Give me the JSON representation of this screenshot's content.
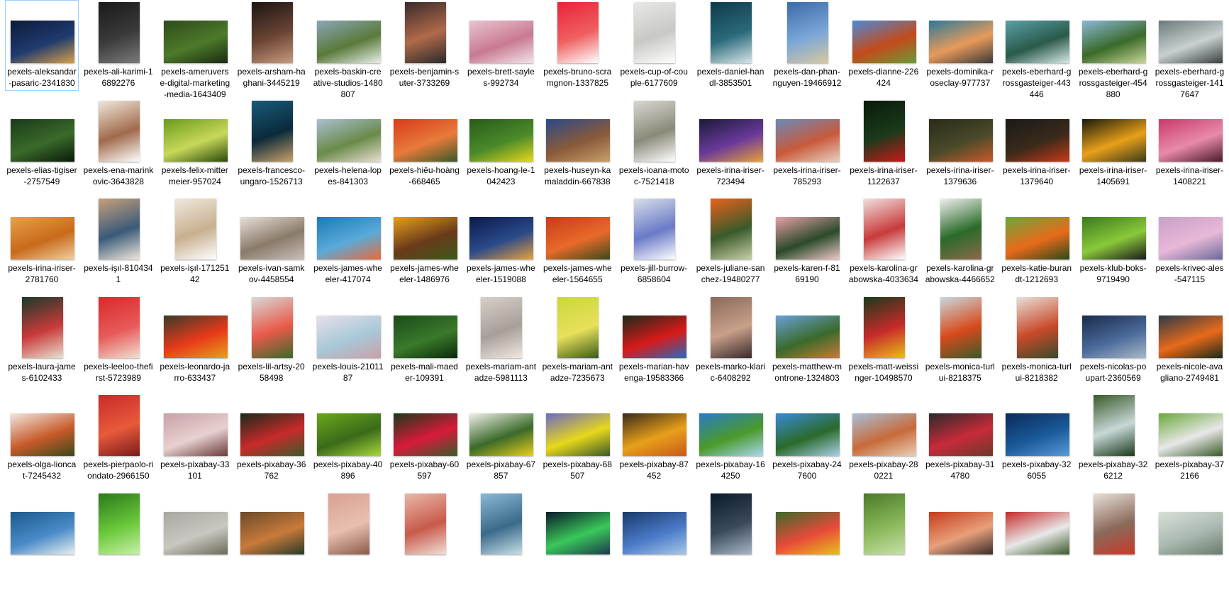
{
  "window": {},
  "files": [
    {
      "name": "pexels-aleksandar-pasaric-2341830",
      "orientation": "landscape",
      "colors": [
        "#0d1a3a",
        "#1f3b6e",
        "#d9a04a"
      ],
      "selected": true
    },
    {
      "name": "pexels-ali-karimi-16892276",
      "orientation": "portrait",
      "colors": [
        "#1a1a1a",
        "#3a3a3a",
        "#7a7a7a"
      ]
    },
    {
      "name": "pexels-ameruverse-digital-marketing-media-1643409",
      "orientation": "landscape",
      "colors": [
        "#2e4a1c",
        "#4c7a2a",
        "#1b2a10"
      ]
    },
    {
      "name": "pexels-arsham-haghani-3445219",
      "orientation": "portrait",
      "colors": [
        "#1c1412",
        "#6a4434",
        "#c89a80"
      ]
    },
    {
      "name": "pexels-baskin-creative-studios-1480807",
      "orientation": "landscape",
      "colors": [
        "#8aa6b8",
        "#5a7a3a",
        "#e9efe8"
      ]
    },
    {
      "name": "pexels-benjamin-suter-3733269",
      "orientation": "portrait",
      "colors": [
        "#3a2a2a",
        "#b06a4a",
        "#2a2a2a"
      ]
    },
    {
      "name": "pexels-brett-sayles-992734",
      "orientation": "landscape",
      "colors": [
        "#e9c4cf",
        "#c97a93",
        "#f2e4e8"
      ]
    },
    {
      "name": "pexels-bruno-scramgnon-1337825",
      "orientation": "portrait",
      "colors": [
        "#e8223a",
        "#f06060",
        "#ffffff"
      ]
    },
    {
      "name": "pexels-cup-of-couple-6177609",
      "orientation": "portrait",
      "colors": [
        "#e8e8e6",
        "#c8c8c4",
        "#ffffff"
      ]
    },
    {
      "name": "pexels-daniel-handl-3853501",
      "orientation": "portrait",
      "colors": [
        "#0f3a4a",
        "#2a6a7a",
        "#d8e6ea"
      ]
    },
    {
      "name": "pexels-dan-phan-nguyen-19466912",
      "orientation": "portrait",
      "colors": [
        "#3a6aa8",
        "#7aa6d8",
        "#d8c8a0"
      ]
    },
    {
      "name": "pexels-dianne-226424",
      "orientation": "landscape",
      "colors": [
        "#4a8ad8",
        "#c44a1a",
        "#6a9a3a"
      ]
    },
    {
      "name": "pexels-dominika-roseclay-977737",
      "orientation": "landscape",
      "colors": [
        "#2a7a9a",
        "#e89a5a",
        "#3a3a3a"
      ]
    },
    {
      "name": "pexels-eberhard-grossgasteiger-443446",
      "orientation": "landscape",
      "colors": [
        "#5aa0a8",
        "#2a5a4a",
        "#d8e8e8"
      ]
    },
    {
      "name": "pexels-eberhard-grossgasteiger-454880",
      "orientation": "landscape",
      "colors": [
        "#8ab8d8",
        "#3a6a2a",
        "#c8d898"
      ]
    },
    {
      "name": "pexels-eberhard-grossgasteiger-1417647",
      "orientation": "landscape",
      "colors": [
        "#6a7a7a",
        "#c8d0d0",
        "#3a4040"
      ]
    },
    {
      "name": "pexels-elias-tigiser-2757549",
      "orientation": "landscape",
      "colors": [
        "#1a3a1a",
        "#3a6a2a",
        "#0a1a0a"
      ]
    },
    {
      "name": "pexels-ena-marinkovic-3643828",
      "orientation": "portrait",
      "colors": [
        "#f0e8dc",
        "#a06a4a",
        "#ffffff"
      ]
    },
    {
      "name": "pexels-felix-mittermeier-957024",
      "orientation": "landscape",
      "colors": [
        "#6a9a1a",
        "#c8d85a",
        "#2a4a0a"
      ]
    },
    {
      "name": "pexels-francesco-ungaro-1526713",
      "orientation": "portrait",
      "colors": [
        "#1a5a7a",
        "#0a2a3a",
        "#c8a06a"
      ]
    },
    {
      "name": "pexels-helena-lopes-841303",
      "orientation": "landscape",
      "colors": [
        "#a8c0d0",
        "#6a8a4a",
        "#e8e0d0"
      ]
    },
    {
      "name": "pexels-hiêu-hoàng-668465",
      "orientation": "landscape",
      "colors": [
        "#d83a1a",
        "#e87a3a",
        "#3a5a2a"
      ]
    },
    {
      "name": "pexels-hoang-le-1042423",
      "orientation": "landscape",
      "colors": [
        "#2a5a1a",
        "#4a8a2a",
        "#e8d81a"
      ]
    },
    {
      "name": "pexels-huseyn-kamaladdin-667838",
      "orientation": "landscape",
      "colors": [
        "#2a4a8a",
        "#8a5a3a",
        "#c8a06a"
      ]
    },
    {
      "name": "pexels-ioana-motoc-7521418",
      "orientation": "portrait",
      "colors": [
        "#d8d8d0",
        "#8a8a7a",
        "#ffffff"
      ]
    },
    {
      "name": "pexels-irina-iriser-723494",
      "orientation": "landscape",
      "colors": [
        "#1a1a3a",
        "#6a3a9a",
        "#e8a03a"
      ]
    },
    {
      "name": "pexels-irina-iriser-785293",
      "orientation": "landscape",
      "colors": [
        "#6a8ab8",
        "#c85a3a",
        "#e8d0c0"
      ]
    },
    {
      "name": "pexels-irina-iriser-1122637",
      "orientation": "portrait",
      "colors": [
        "#0a1a0a",
        "#1a3a1a",
        "#c81a1a"
      ]
    },
    {
      "name": "pexels-irina-iriser-1379636",
      "orientation": "landscape",
      "colors": [
        "#2a2a1a",
        "#4a4a2a",
        "#c85a2a"
      ]
    },
    {
      "name": "pexels-irina-iriser-1379640",
      "orientation": "landscape",
      "colors": [
        "#1a1a1a",
        "#3a2a1a",
        "#c83a1a"
      ]
    },
    {
      "name": "pexels-irina-iriser-1405691",
      "orientation": "landscape",
      "colors": [
        "#1a1a0a",
        "#e8a01a",
        "#3a3a1a"
      ]
    },
    {
      "name": "pexels-irina-iriser-1408221",
      "orientation": "landscape",
      "colors": [
        "#c83a6a",
        "#e88aaa",
        "#4a1a2a"
      ]
    },
    {
      "name": "pexels-irina-iriser-2781760",
      "orientation": "landscape",
      "colors": [
        "#e8a04a",
        "#c86a1a",
        "#f0d0a0"
      ]
    },
    {
      "name": "pexels-işıl-8104341",
      "orientation": "portrait",
      "colors": [
        "#c8a07a",
        "#3a5a7a",
        "#f0e8d8"
      ]
    },
    {
      "name": "pexels-işıl-17125142",
      "orientation": "portrait",
      "colors": [
        "#f0e8dc",
        "#c8b090",
        "#ffffff"
      ]
    },
    {
      "name": "pexels-ivan-samkov-4458554",
      "orientation": "landscape",
      "colors": [
        "#e8e0d8",
        "#8a7a6a",
        "#c8c0b8"
      ]
    },
    {
      "name": "pexels-james-wheeler-417074",
      "orientation": "landscape",
      "colors": [
        "#1a7ab8",
        "#5aaad8",
        "#e86a3a"
      ]
    },
    {
      "name": "pexels-james-wheeler-1486976",
      "orientation": "landscape",
      "colors": [
        "#e8a01a",
        "#6a3a1a",
        "#3a5a1a"
      ]
    },
    {
      "name": "pexels-james-wheeler-1519088",
      "orientation": "landscape",
      "colors": [
        "#0a1a4a",
        "#2a4a8a",
        "#e8a03a"
      ]
    },
    {
      "name": "pexels-james-wheeler-1564655",
      "orientation": "landscape",
      "colors": [
        "#c83a1a",
        "#e86a2a",
        "#3a4a1a"
      ]
    },
    {
      "name": "pexels-jill-burrow-6858604",
      "orientation": "portrait",
      "colors": [
        "#d8e0e8",
        "#6a7ac8",
        "#ffffff"
      ]
    },
    {
      "name": "pexels-juliane-sanchez-19480277",
      "orientation": "portrait",
      "colors": [
        "#e8621a",
        "#3a5a2a",
        "#c8d0a8"
      ]
    },
    {
      "name": "pexels-karen-f-8169190",
      "orientation": "landscape",
      "colors": [
        "#e8a0a8",
        "#2a4a2a",
        "#f0c8c8"
      ]
    },
    {
      "name": "pexels-karolina-grabowska-4033634",
      "orientation": "portrait",
      "colors": [
        "#f0e0dc",
        "#c83a3a",
        "#ffffff"
      ]
    },
    {
      "name": "pexels-karolina-grabowska-4466652",
      "orientation": "portrait",
      "colors": [
        "#f0f0ee",
        "#2a6a2a",
        "#8a6a4a"
      ]
    },
    {
      "name": "pexels-katie-burandt-1212693",
      "orientation": "landscape",
      "colors": [
        "#6aa83a",
        "#e86a1a",
        "#2a4a1a"
      ]
    },
    {
      "name": "pexels-klub-boks-9719490",
      "orientation": "landscape",
      "colors": [
        "#3a7a1a",
        "#8ac83a",
        "#1a1a1a"
      ]
    },
    {
      "name": "pexels-krivec-ales-547115",
      "orientation": "landscape",
      "colors": [
        "#c8a0c8",
        "#e8b8d8",
        "#6a6a9a"
      ]
    },
    {
      "name": "pexels-laura-james-6102433",
      "orientation": "portrait",
      "colors": [
        "#1a3a2a",
        "#c83a3a",
        "#e8e0d0"
      ]
    },
    {
      "name": "pexels-leeloo-thefirst-5723989",
      "orientation": "portrait",
      "colors": [
        "#d82a2a",
        "#e85a5a",
        "#f0e0d0"
      ]
    },
    {
      "name": "pexels-leonardo-jarro-633437",
      "orientation": "landscape",
      "colors": [
        "#3a3a2a",
        "#e83a1a",
        "#e8a01a"
      ]
    },
    {
      "name": "pexels-lil-artsy-2058498",
      "orientation": "portrait",
      "colors": [
        "#d8d8d8",
        "#e85a4a",
        "#3a6a2a"
      ]
    },
    {
      "name": "pexels-louis-2101187",
      "orientation": "landscape",
      "colors": [
        "#e8e0e8",
        "#a8c8d8",
        "#c8a0a8"
      ]
    },
    {
      "name": "pexels-mali-maeder-109391",
      "orientation": "landscape",
      "colors": [
        "#1a4a1a",
        "#3a7a2a",
        "#0a2a0a"
      ]
    },
    {
      "name": "pexels-mariam-antadze-5981113",
      "orientation": "portrait",
      "colors": [
        "#d8d0c8",
        "#a8a098",
        "#f0e8e0"
      ]
    },
    {
      "name": "pexels-mariam-antadze-7235673",
      "orientation": "portrait",
      "colors": [
        "#c8d83a",
        "#e8e05a",
        "#3a5a1a"
      ]
    },
    {
      "name": "pexels-marian-havenga-19583366",
      "orientation": "landscape",
      "colors": [
        "#1a2a1a",
        "#d81a1a",
        "#2a6ab8"
      ]
    },
    {
      "name": "pexels-marko-klaric-6408292",
      "orientation": "portrait",
      "colors": [
        "#8a6a5a",
        "#c8a08a",
        "#3a2a2a"
      ]
    },
    {
      "name": "pexels-matthew-montrone-1324803",
      "orientation": "landscape",
      "colors": [
        "#6aa0d8",
        "#3a6a2a",
        "#c87a3a"
      ]
    },
    {
      "name": "pexels-matt-weissinger-10498570",
      "orientation": "portrait",
      "colors": [
        "#1a3a1a",
        "#c82a2a",
        "#e8c01a"
      ]
    },
    {
      "name": "pexels-monica-turlui-8218375",
      "orientation": "portrait",
      "colors": [
        "#c8d8e0",
        "#d84a1a",
        "#3a5a2a"
      ]
    },
    {
      "name": "pexels-monica-turlui-8218382",
      "orientation": "portrait",
      "colors": [
        "#e8e0d8",
        "#c84a2a",
        "#3a4a2a"
      ]
    },
    {
      "name": "pexels-nicolas-poupart-2360569",
      "orientation": "landscape",
      "colors": [
        "#1a2a4a",
        "#4a6a9a",
        "#a8b8c8"
      ]
    },
    {
      "name": "pexels-nicole-avagliano-2749481",
      "orientation": "landscape",
      "colors": [
        "#2a3a4a",
        "#e86a1a",
        "#1a2a1a"
      ]
    },
    {
      "name": "pexels-olga-lioncat-7245432",
      "orientation": "landscape",
      "colors": [
        "#f0e8e0",
        "#c85a2a",
        "#3a4a1a"
      ]
    },
    {
      "name": "pexels-pierpaolo-riondato-2966150",
      "orientation": "portrait",
      "colors": [
        "#c82a2a",
        "#e85a3a",
        "#7a1a1a"
      ]
    },
    {
      "name": "pexels-pixabay-33101",
      "orientation": "landscape",
      "colors": [
        "#c8a0a8",
        "#e8d0d0",
        "#6a3a3a"
      ]
    },
    {
      "name": "pexels-pixabay-36762",
      "orientation": "landscape",
      "colors": [
        "#1a2a1a",
        "#c82a2a",
        "#3a5a2a"
      ]
    },
    {
      "name": "pexels-pixabay-40896",
      "orientation": "landscape",
      "colors": [
        "#6aa81a",
        "#3a6a1a",
        "#a8d83a"
      ]
    },
    {
      "name": "pexels-pixabay-60597",
      "orientation": "landscape",
      "colors": [
        "#1a3a1a",
        "#d81a3a",
        "#3a5a2a"
      ]
    },
    {
      "name": "pexels-pixabay-67857",
      "orientation": "landscape",
      "colors": [
        "#f0f0e8",
        "#3a6a2a",
        "#e8d01a"
      ]
    },
    {
      "name": "pexels-pixabay-68507",
      "orientation": "landscape",
      "colors": [
        "#6a6ac8",
        "#e8d81a",
        "#3a5a2a"
      ]
    },
    {
      "name": "pexels-pixabay-87452",
      "orientation": "landscape",
      "colors": [
        "#3a2a1a",
        "#e8a01a",
        "#c85a1a"
      ]
    },
    {
      "name": "pexels-pixabay-164250",
      "orientation": "landscape",
      "colors": [
        "#2a7ac8",
        "#4a9a2a",
        "#a8d8f0"
      ]
    },
    {
      "name": "pexels-pixabay-247600",
      "orientation": "landscape",
      "colors": [
        "#3a8ad8",
        "#2a6a2a",
        "#a8d0e8"
      ]
    },
    {
      "name": "pexels-pixabay-280221",
      "orientation": "landscape",
      "colors": [
        "#a8c0d8",
        "#c86a3a",
        "#e8d0b8"
      ]
    },
    {
      "name": "pexels-pixabay-314780",
      "orientation": "landscape",
      "colors": [
        "#2a2a2a",
        "#c82a3a",
        "#6a3a2a"
      ]
    },
    {
      "name": "pexels-pixabay-326055",
      "orientation": "landscape",
      "colors": [
        "#0a2a5a",
        "#1a5a9a",
        "#5a9ad8"
      ]
    },
    {
      "name": "pexels-pixabay-326212",
      "orientation": "portrait",
      "colors": [
        "#3a5a2a",
        "#c8d8d8",
        "#1a3a1a"
      ]
    },
    {
      "name": "pexels-pixabay-372166",
      "orientation": "landscape",
      "colors": [
        "#6aa83a",
        "#e8e8e8",
        "#3a5a2a"
      ]
    },
    {
      "name": "",
      "orientation": "landscape",
      "colors": [
        "#1a5a8a",
        "#4a8ac8",
        "#e8f0f0"
      ]
    },
    {
      "name": "",
      "orientation": "portrait",
      "colors": [
        "#2a7a1a",
        "#6ac83a",
        "#c8f0a8"
      ]
    },
    {
      "name": "",
      "orientation": "landscape",
      "colors": [
        "#a8a8a0",
        "#c8c8c0",
        "#6a6a5a"
      ]
    },
    {
      "name": "",
      "orientation": "landscape",
      "colors": [
        "#6a4a2a",
        "#c87a3a",
        "#2a3a2a"
      ]
    },
    {
      "name": "",
      "orientation": "portrait",
      "colors": [
        "#d8a090",
        "#e8c0b0",
        "#8a5a4a"
      ]
    },
    {
      "name": "",
      "orientation": "portrait",
      "colors": [
        "#e8b8a8",
        "#c85a4a",
        "#f0e0d8"
      ]
    },
    {
      "name": "",
      "orientation": "portrait",
      "colors": [
        "#8ab8d8",
        "#3a6a8a",
        "#c8e0e8"
      ]
    },
    {
      "name": "",
      "orientation": "landscape",
      "colors": [
        "#0a1a2a",
        "#3ac85a",
        "#1a3a4a"
      ]
    },
    {
      "name": "",
      "orientation": "landscape",
      "colors": [
        "#1a3a6a",
        "#4a7ac8",
        "#a8c8e8"
      ]
    },
    {
      "name": "",
      "orientation": "portrait",
      "colors": [
        "#0a1a2a",
        "#3a4a5a",
        "#a8b8c8"
      ]
    },
    {
      "name": "",
      "orientation": "landscape",
      "colors": [
        "#3a6a2a",
        "#e84a3a",
        "#e8c01a"
      ]
    },
    {
      "name": "",
      "orientation": "portrait",
      "colors": [
        "#4a7a2a",
        "#8ab85a",
        "#c8e0a8"
      ]
    },
    {
      "name": "",
      "orientation": "landscape",
      "colors": [
        "#c83a1a",
        "#e8a07a",
        "#3a2a2a"
      ]
    },
    {
      "name": "",
      "orientation": "landscape",
      "colors": [
        "#c82a2a",
        "#e8e8e8",
        "#3a5a2a"
      ]
    },
    {
      "name": "",
      "orientation": "portrait",
      "colors": [
        "#e8e0d8",
        "#8a6a5a",
        "#c83a2a"
      ]
    },
    {
      "name": "",
      "orientation": "landscape",
      "colors": [
        "#d8e0d8",
        "#a8b8b0",
        "#6a7a6a"
      ]
    }
  ]
}
